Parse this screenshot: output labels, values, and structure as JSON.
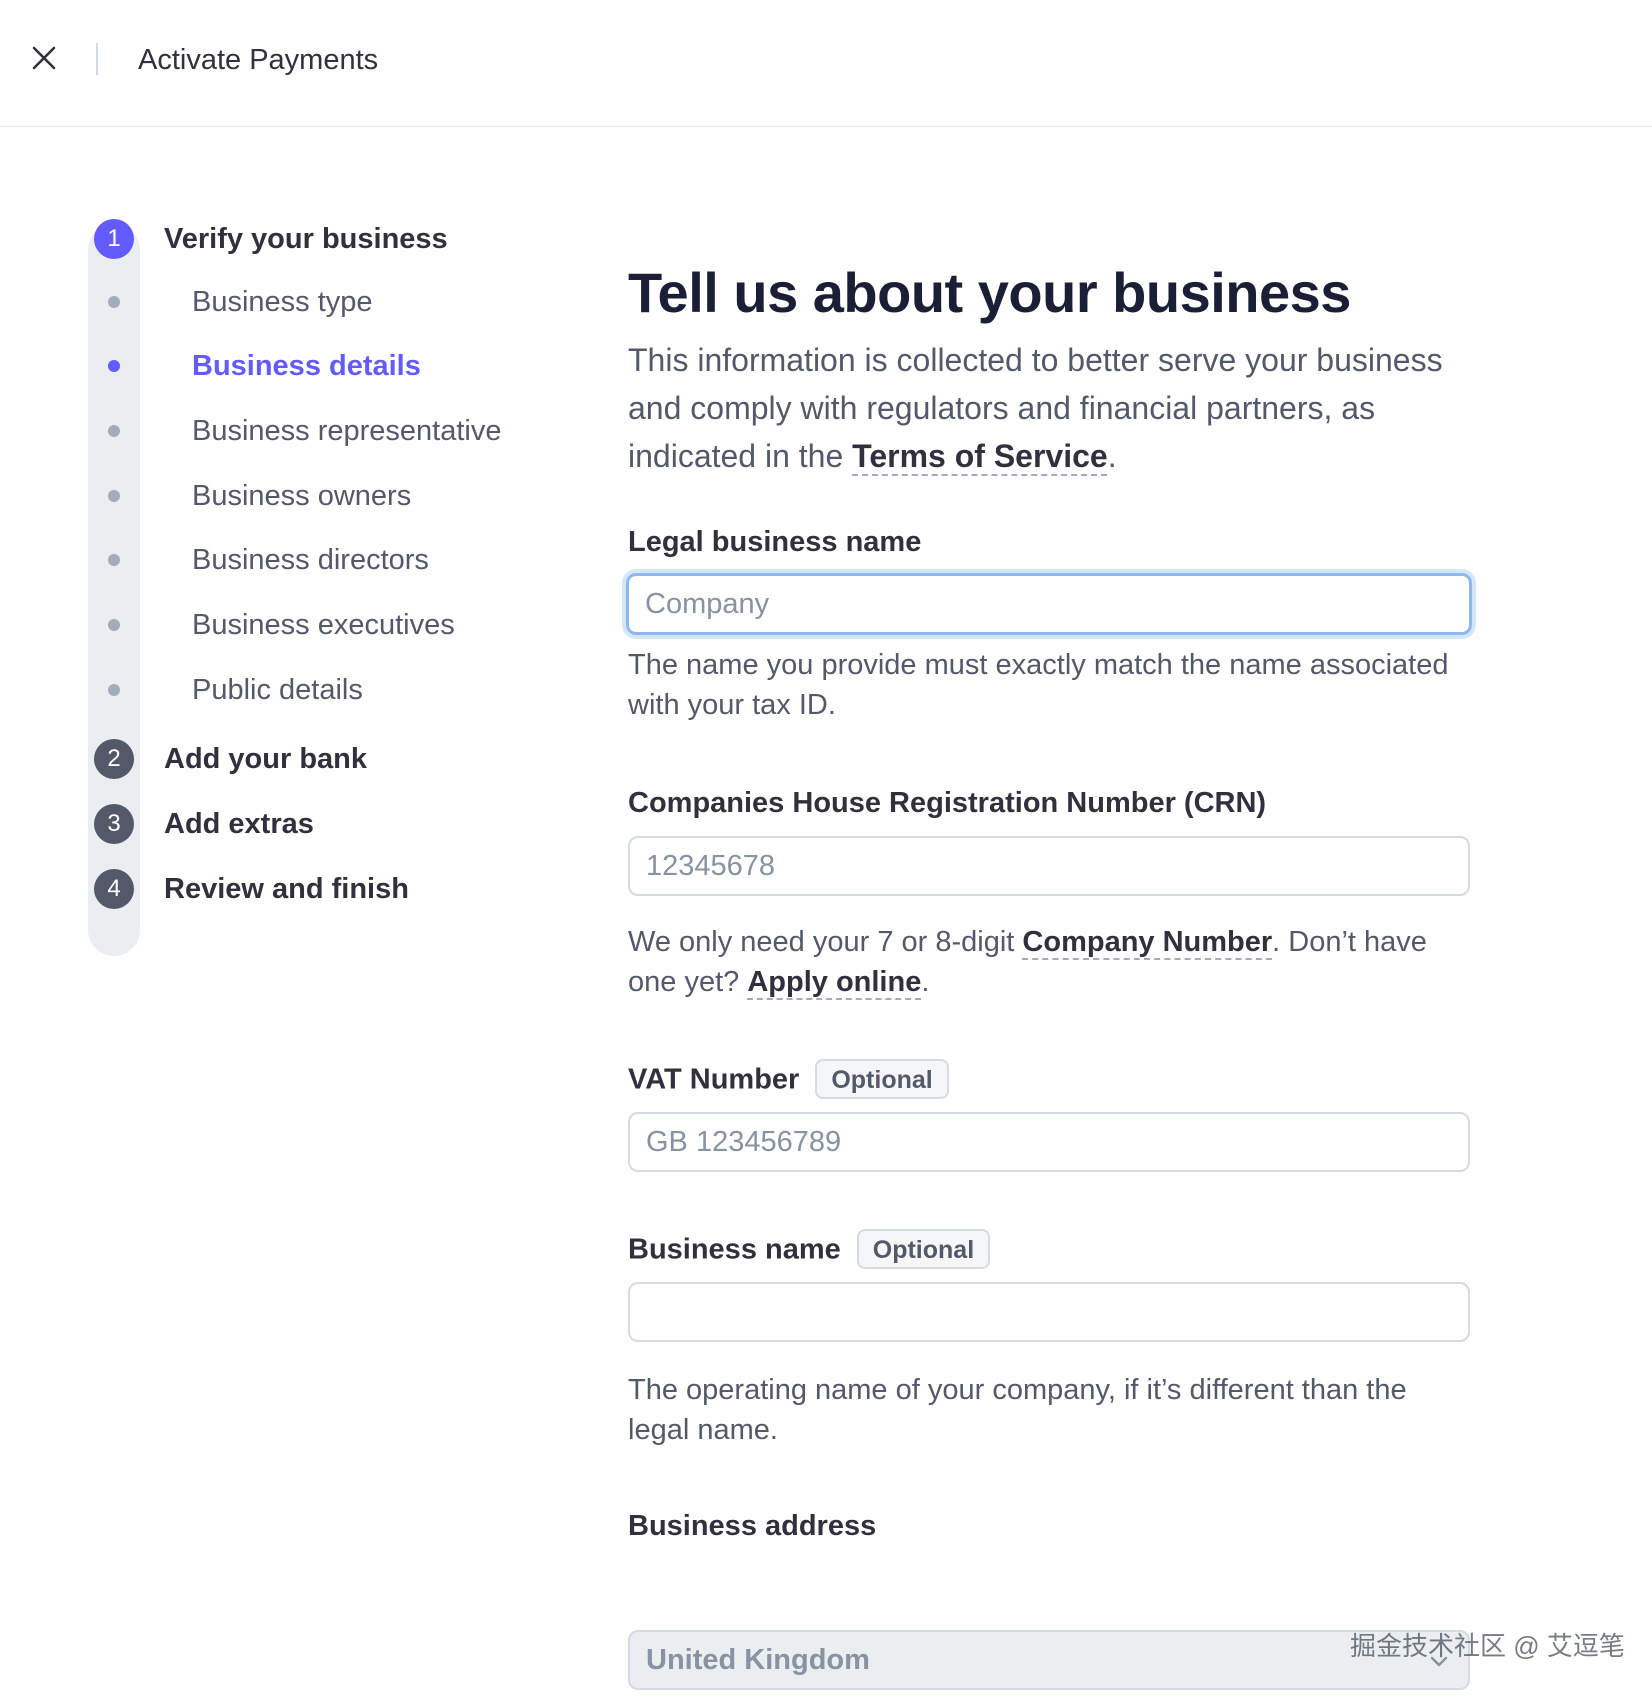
{
  "header": {
    "title": "Activate Payments"
  },
  "sidebar": {
    "steps": [
      {
        "number": "1",
        "label": "Verify your business",
        "active": true
      },
      {
        "number": "2",
        "label": "Add your bank"
      },
      {
        "number": "3",
        "label": "Add extras"
      },
      {
        "number": "4",
        "label": "Review and finish"
      }
    ],
    "substeps": [
      {
        "label": "Business type"
      },
      {
        "label": "Business details",
        "active": true
      },
      {
        "label": "Business representative"
      },
      {
        "label": "Business owners"
      },
      {
        "label": "Business directors"
      },
      {
        "label": "Business executives"
      },
      {
        "label": "Public details"
      }
    ]
  },
  "main": {
    "title": "Tell us about your business",
    "intro_before_link": "This information is collected to better serve your business and comply with regulators and financial partners, as indicated in the ",
    "intro_link": "Terms of Service",
    "intro_after_link": ".",
    "legal_name": {
      "label": "Legal business name",
      "placeholder": "Company",
      "value": "",
      "helper": "The name you provide must exactly match the name associated with your tax ID."
    },
    "crn": {
      "label": "Companies House Registration Number (CRN)",
      "placeholder": "12345678",
      "value": "",
      "helper_before": "We only need your 7 or 8-digit ",
      "helper_link1": "Company Number",
      "helper_middle": ". Don’t have one yet? ",
      "helper_link2": "Apply online",
      "helper_after": "."
    },
    "vat": {
      "label": "VAT Number",
      "badge": "Optional",
      "placeholder": "GB 123456789",
      "value": ""
    },
    "business_name": {
      "label": "Business name",
      "badge": "Optional",
      "placeholder": "",
      "value": "",
      "helper": "The operating name of your company, if it’s different than the legal name."
    },
    "address": {
      "label": "Business address",
      "country": "United Kingdom"
    }
  },
  "watermark": "掘金技术社区 @ 艾逗笔",
  "colors": {
    "accent": "#635bff",
    "text_dark": "#30313d",
    "text_muted": "#545969",
    "focus_ring": "#8fb8ee"
  }
}
